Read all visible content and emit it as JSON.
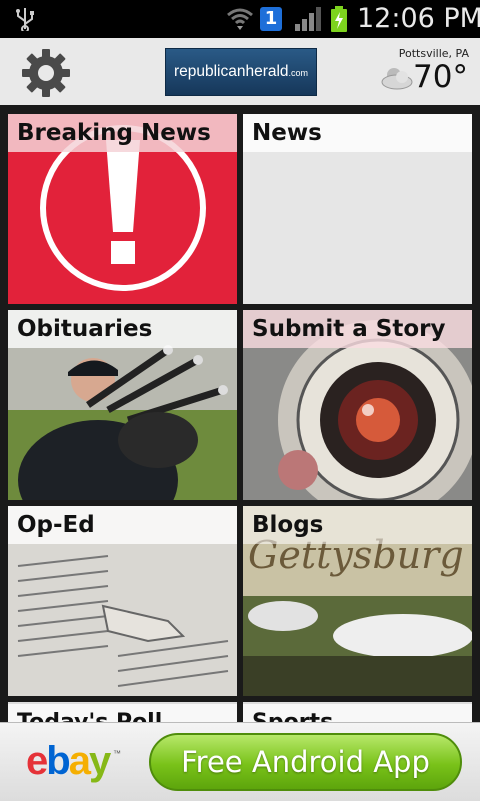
{
  "status_bar": {
    "notification_badge": "1",
    "time": "12:06 PM"
  },
  "header": {
    "logo_text": "republicanherald",
    "logo_suffix": ".com",
    "location": "Pottsville, PA",
    "temperature": "70°",
    "weather_icon": "partly-cloudy-icon"
  },
  "tiles": [
    {
      "label": "Breaking News"
    },
    {
      "label": "News"
    },
    {
      "label": "Obituaries"
    },
    {
      "label": "Submit a Story"
    },
    {
      "label": "Op-Ed"
    },
    {
      "label": "Blogs"
    },
    {
      "label": "Today's Poll"
    },
    {
      "label": "Sports"
    }
  ],
  "ad": {
    "brand": [
      "e",
      "b",
      "a",
      "y"
    ],
    "brand_tm": "™",
    "button_label": "Free Android App"
  },
  "colors": {
    "breaking_red": "#e2223a",
    "logo_blue": "#1f4b73",
    "ad_green": "#79c219"
  }
}
